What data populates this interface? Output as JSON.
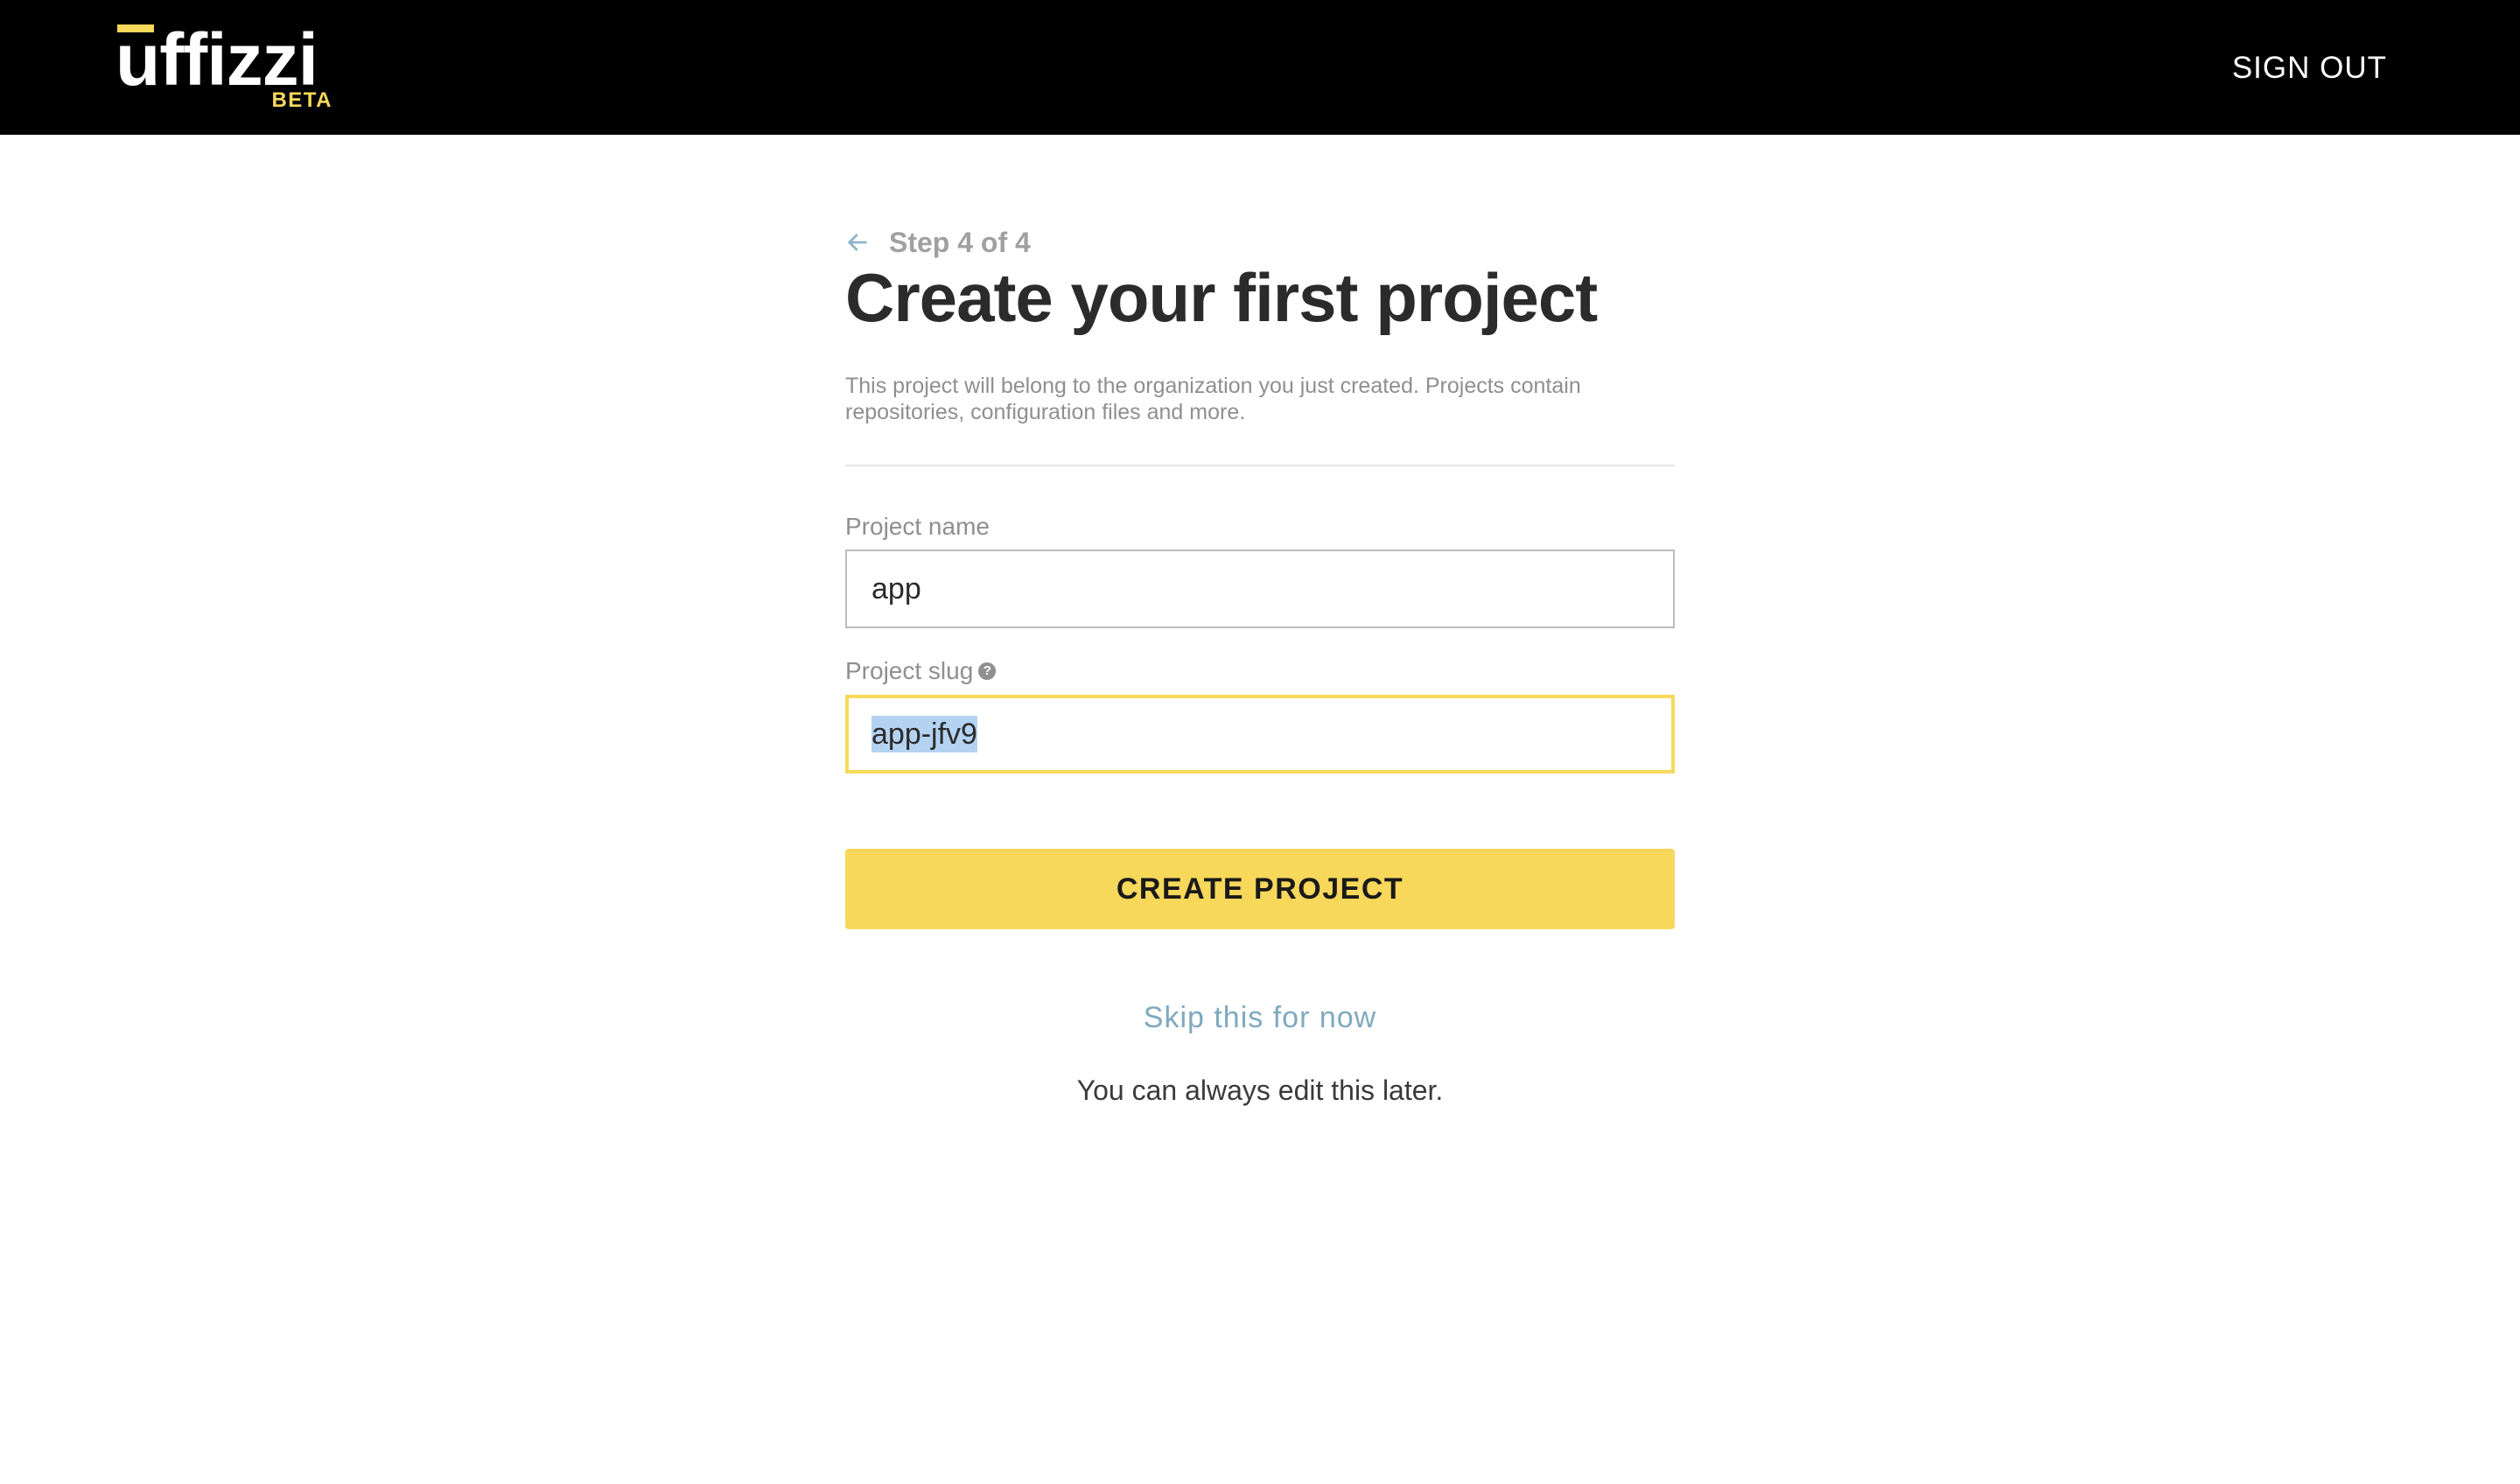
{
  "header": {
    "logo_text": "uffizzi",
    "logo_badge": "BETA",
    "sign_out_label": "SIGN OUT"
  },
  "wizard": {
    "step_text": "Step 4 of 4",
    "title": "Create your first project",
    "description": "This project will belong to the organization you just created. Projects contain repositories, configuration files and more."
  },
  "form": {
    "project_name": {
      "label": "Project name",
      "value": "app"
    },
    "project_slug": {
      "label": "Project slug",
      "value": "app-jfv9",
      "help_icon": "?"
    },
    "submit_label": "CREATE PROJECT",
    "skip_label": "Skip this for now",
    "footnote": "You can always edit this later."
  },
  "colors": {
    "header_bg": "#000000",
    "accent_yellow": "#f7d85b",
    "link_blue": "#7fa9bf",
    "selection": "#b4d3f2"
  },
  "icons": {
    "back": "arrow-left-icon",
    "help": "question-circle-icon"
  }
}
